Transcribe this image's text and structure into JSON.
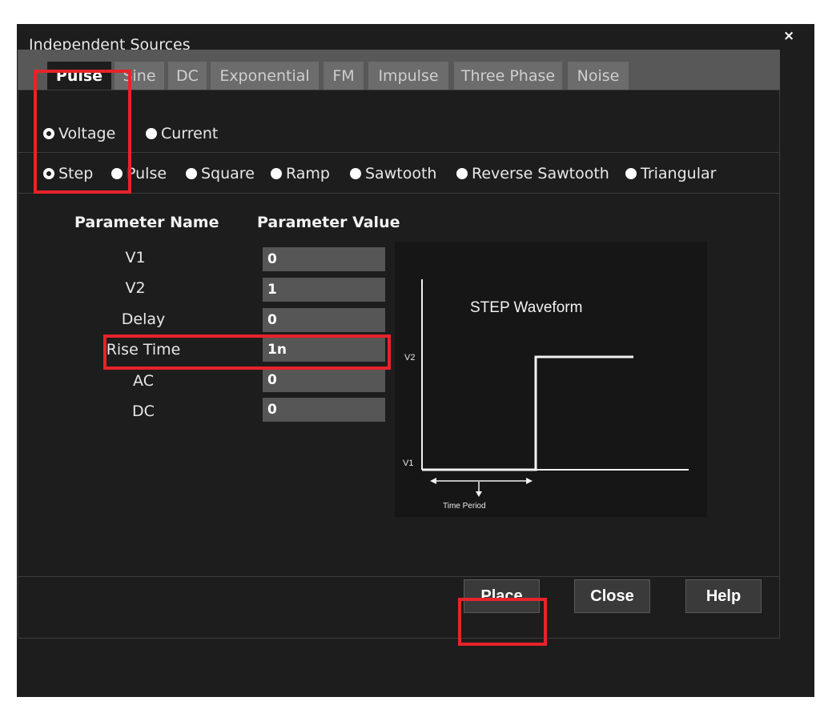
{
  "window": {
    "title": "Independent Sources",
    "close_glyph": "×"
  },
  "tabs": [
    "Pulse",
    "Sine",
    "DC",
    "Exponential",
    "FM",
    "Impulse",
    "Three Phase",
    "Noise"
  ],
  "source_type": {
    "options": [
      "Voltage",
      "Current"
    ],
    "selected": "Voltage"
  },
  "waveform_shape": {
    "options": [
      "Step",
      "Pulse",
      "Square",
      "Ramp",
      "Sawtooth",
      "Reverse Sawtooth",
      "Triangular"
    ],
    "selected": "Step"
  },
  "parameters": {
    "name_header": "Parameter Name",
    "value_header": "Parameter Value",
    "rows": [
      {
        "name": "V1",
        "value": "0"
      },
      {
        "name": "V2",
        "value": "1"
      },
      {
        "name": "Delay",
        "value": "0"
      },
      {
        "name": "Rise Time",
        "value": "1n"
      },
      {
        "name": "AC",
        "value": "0"
      },
      {
        "name": "DC",
        "value": "0"
      }
    ]
  },
  "waveform_preview": {
    "title": "STEP Waveform",
    "label_v2": "V2",
    "label_v1": "V1",
    "label_time": "Time Period"
  },
  "buttons": {
    "place": "Place",
    "close": "Close",
    "help": "Help"
  },
  "colors": {
    "highlight": "#e8232a",
    "dialog_bg": "#1d1d1d",
    "tab_inactive": "#6c6c6c",
    "input_bg": "#565656"
  }
}
